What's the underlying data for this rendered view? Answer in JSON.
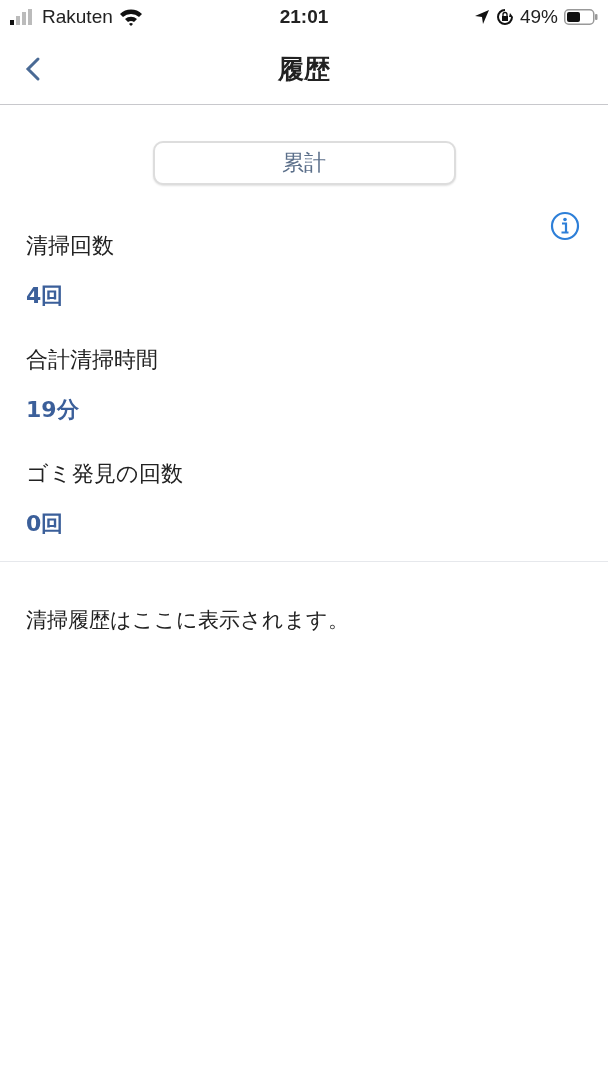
{
  "status_bar": {
    "carrier": "Rakuten",
    "time": "21:01",
    "battery": "49%"
  },
  "nav_bar": {
    "title": "履歴"
  },
  "segment": {
    "label": "累計"
  },
  "stats": [
    {
      "label": "清掃回数",
      "value": "4回"
    },
    {
      "label": "合計清掃時間",
      "value": "19分"
    },
    {
      "label": "ゴミ発見の回数",
      "value": "0回"
    }
  ],
  "history": {
    "message": "清掃履歴はここに表示されます。"
  }
}
